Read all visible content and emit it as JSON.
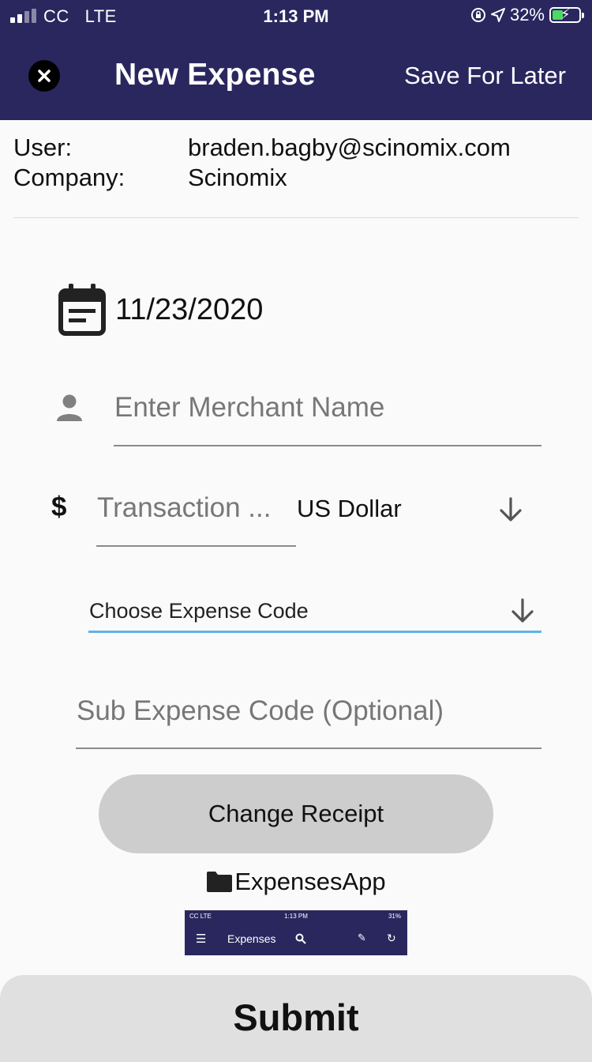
{
  "status_bar": {
    "carrier": "CC",
    "network": "LTE",
    "time": "1:13 PM",
    "battery_percent": "32%",
    "icons": [
      "signal-icon",
      "orientation-lock-icon",
      "location-arrow-icon",
      "battery-charging-icon"
    ]
  },
  "header": {
    "title": "New Expense",
    "save_later_label": "Save For Later",
    "close_icon": "close-icon",
    "background": "#2a275f"
  },
  "account": {
    "user_label": "User:",
    "user_value": "braden.bagby@scinomix.com",
    "company_label": "Company:",
    "company_value": "Scinomix"
  },
  "form": {
    "date": "11/23/2020",
    "merchant_placeholder": "Enter Merchant Name",
    "currency_symbol": "$",
    "amount_placeholder": "Transaction ...",
    "currency_value": "US Dollar",
    "expense_code_placeholder": "Choose Expense Code",
    "sub_expense_placeholder": "Sub Expense Code (Optional)",
    "accent_color": "#5eb3e4"
  },
  "receipt": {
    "change_label": "Change Receipt",
    "folder_name": "ExpensesApp",
    "thumbnail": {
      "carrier": "CC  LTE",
      "time": "1:13 PM",
      "battery": "31%",
      "title": "Expenses"
    }
  },
  "submit_label": "Submit"
}
